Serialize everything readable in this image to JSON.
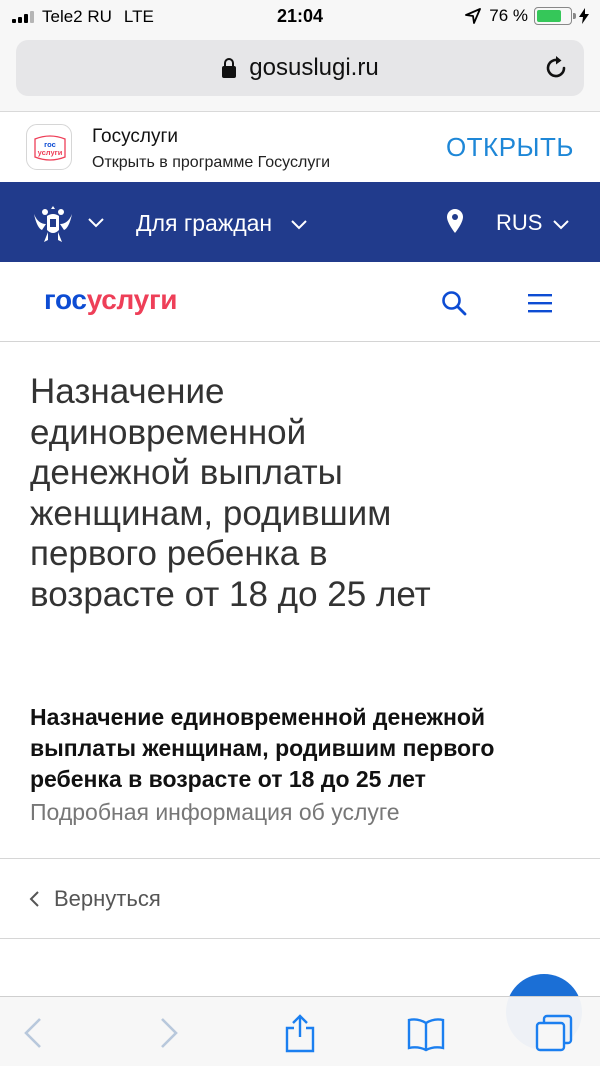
{
  "status_bar": {
    "carrier": "Tele2 RU",
    "network": "LTE",
    "time": "21:04",
    "battery_percent": "76 %",
    "battery_level": 0.76
  },
  "browser": {
    "url": "gosuslugi.ru"
  },
  "app_banner": {
    "icon_text_top": "гос",
    "icon_text_bottom": "услуги",
    "title": "Госуслуги",
    "subtitle": "Открыть в программе Госуслуги",
    "open_label": "ОТКРЫТЬ"
  },
  "nav": {
    "citizens_label": "Для граждан",
    "language": "RUS"
  },
  "header": {
    "logo_part1": "гос",
    "logo_part2": "услуги"
  },
  "main": {
    "title": "Назначение единовременной денежной выплаты женщинам, родившим первого ребенка в возрасте от 18 до 25 лет",
    "service_name": "Назначение единовременной денежной выплаты женщинам, родившим первого ребенка в возрасте от 18 до 25 лет",
    "details_link": "Подробная информация об услуге",
    "back_label": "Вернуться"
  },
  "colors": {
    "nav_blue": "#213b8c",
    "logo_blue": "#0d4cd3",
    "logo_red": "#ee3f58",
    "link_blue": "#1e87d7",
    "ios_blue": "#1b7ff0"
  }
}
